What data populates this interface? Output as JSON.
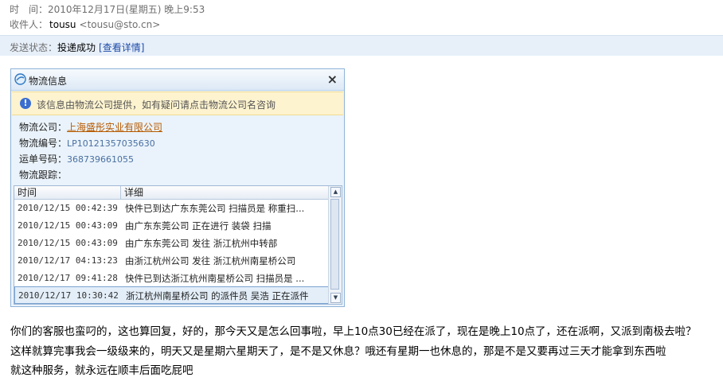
{
  "header": {
    "time_label": "时　间：",
    "time_value": "2010年12月17日(星期五) 晚上9:53",
    "to_label": "收件人：",
    "to_name": "tousu",
    "to_addr": "<tousu@sto.cn>"
  },
  "status": {
    "label": "发送状态：",
    "value": "投递成功",
    "link": "[查看详情]"
  },
  "panel": {
    "title": "物流信息",
    "close": "×",
    "notice": "该信息由物流公司提供，如有疑问请点击物流公司名咨询",
    "company_label": "物流公司：",
    "company_value": "上海盛彤实业有限公司",
    "code_label": "物流编号：",
    "code_value": "LP10121357035630",
    "waybill_label": "运单号码：",
    "waybill_value": "368739661055",
    "track_label": "物流跟踪：",
    "col_time": "时间",
    "col_detail": "详细",
    "rows": [
      {
        "time": "2010/12/15 00:42:39",
        "detail": "快件已到达广东东莞公司 扫描员是 称重扫..."
      },
      {
        "time": "2010/12/15 00:43:09",
        "detail": "由广东东莞公司 正在进行 装袋 扫描"
      },
      {
        "time": "2010/12/15 00:43:09",
        "detail": "由广东东莞公司 发往 浙江杭州中转部"
      },
      {
        "time": "2010/12/17 04:13:23",
        "detail": "由浙江杭州公司 发往 浙江杭州南星桥公司"
      },
      {
        "time": "2010/12/17 09:41:28",
        "detail": "快件已到达浙江杭州南星桥公司 扫描员是 ..."
      },
      {
        "time": "2010/12/17 10:30:42",
        "detail": "浙江杭州南星桥公司 的派件员 吴浩 正在派件"
      }
    ]
  },
  "body": {
    "line1": "你们的客服也蛮叼的，这也算回复，好的，那今天又是怎么回事啦，早上10点30已经在派了，现在是晚上10点了，还在派啊，又派到南极去啦？",
    "line2": "这样就算完事我会一级级来的，明天又是星期六星期天了，是不是又休息？哦还有星期一也休息的，那是不是又要再过三天才能拿到东西啦",
    "line3": "就这种服务，就永远在顺丰后面吃屁吧"
  }
}
